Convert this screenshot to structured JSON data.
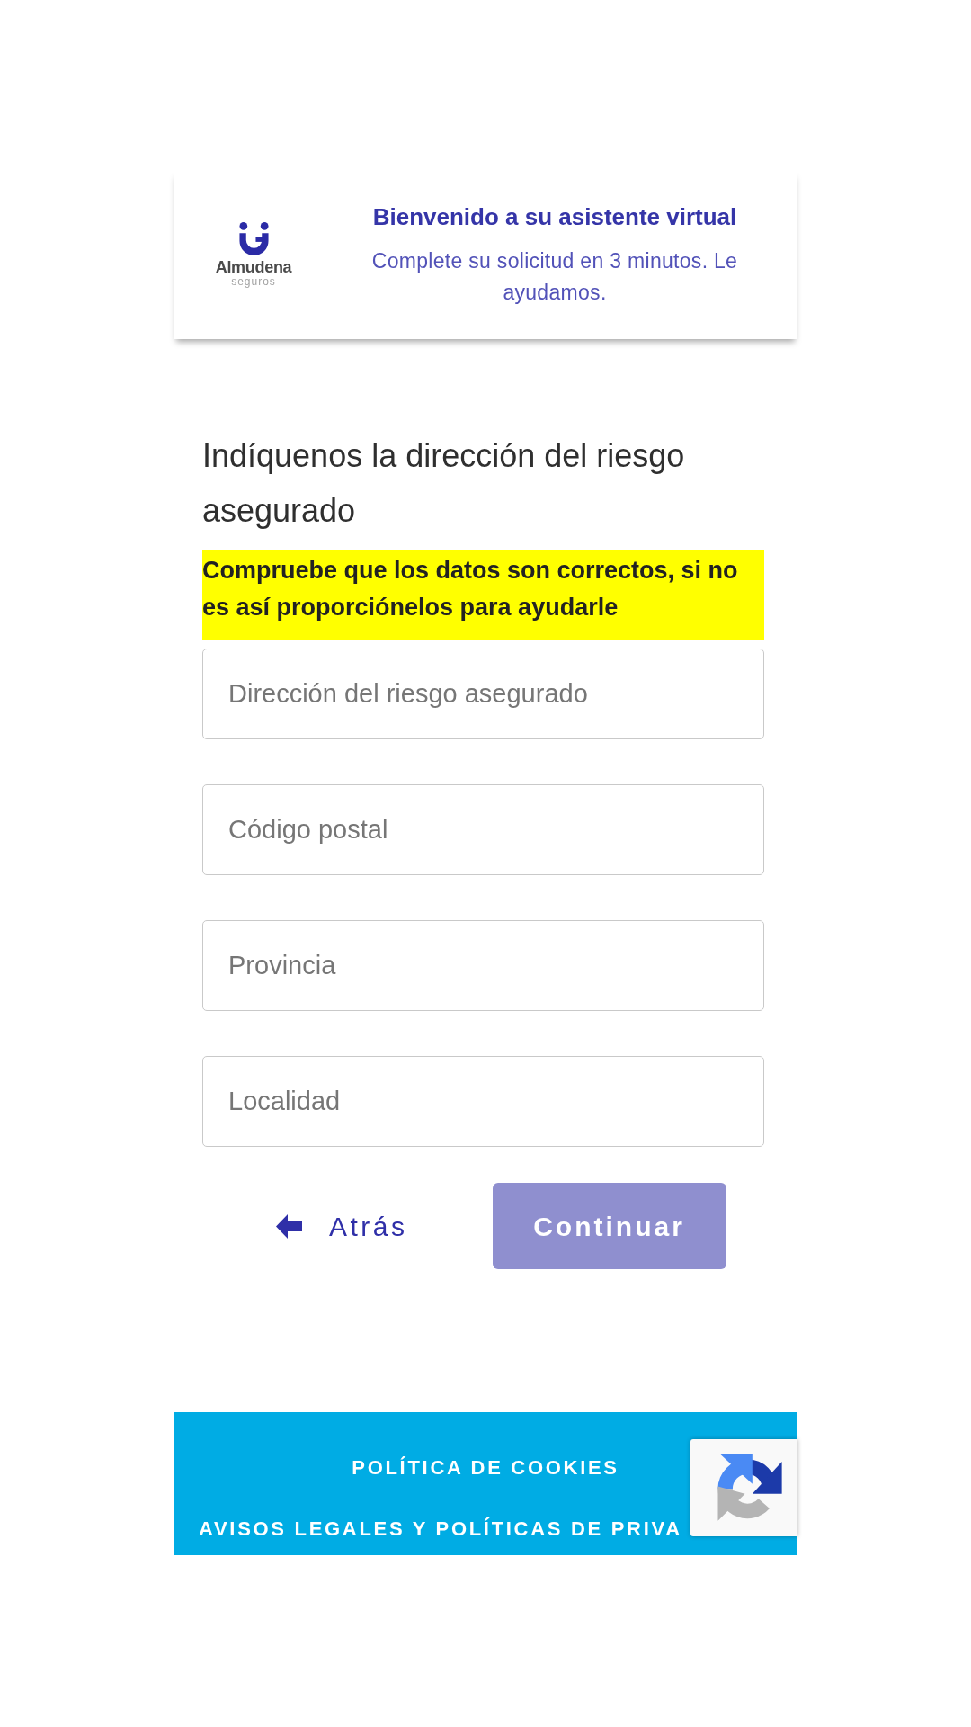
{
  "header": {
    "logo": {
      "name": "Almudena",
      "tagline": "seguros"
    },
    "title": "Bienvenido a su asistente virtual",
    "subtitle": "Complete su solicitud en 3 minutos. Le ayudamos."
  },
  "form": {
    "heading": "Indíquenos la dirección del riesgo asegurado",
    "notice": "Compruebe que los datos son correctos, si no es así proporciónelos para ayudarle",
    "fields": [
      {
        "placeholder": "Dirección del riesgo asegurado"
      },
      {
        "placeholder": "Código postal"
      },
      {
        "placeholder": "Provincia"
      },
      {
        "placeholder": "Localidad"
      }
    ]
  },
  "actions": {
    "back": {
      "label": "Atrás"
    },
    "continue": {
      "label": "Continuar",
      "disabled": true
    }
  },
  "footer": {
    "links": [
      "POLÍTICA DE COOKIES",
      "AVISOS LEGALES Y POLÍTICAS DE PRIVA"
    ]
  }
}
